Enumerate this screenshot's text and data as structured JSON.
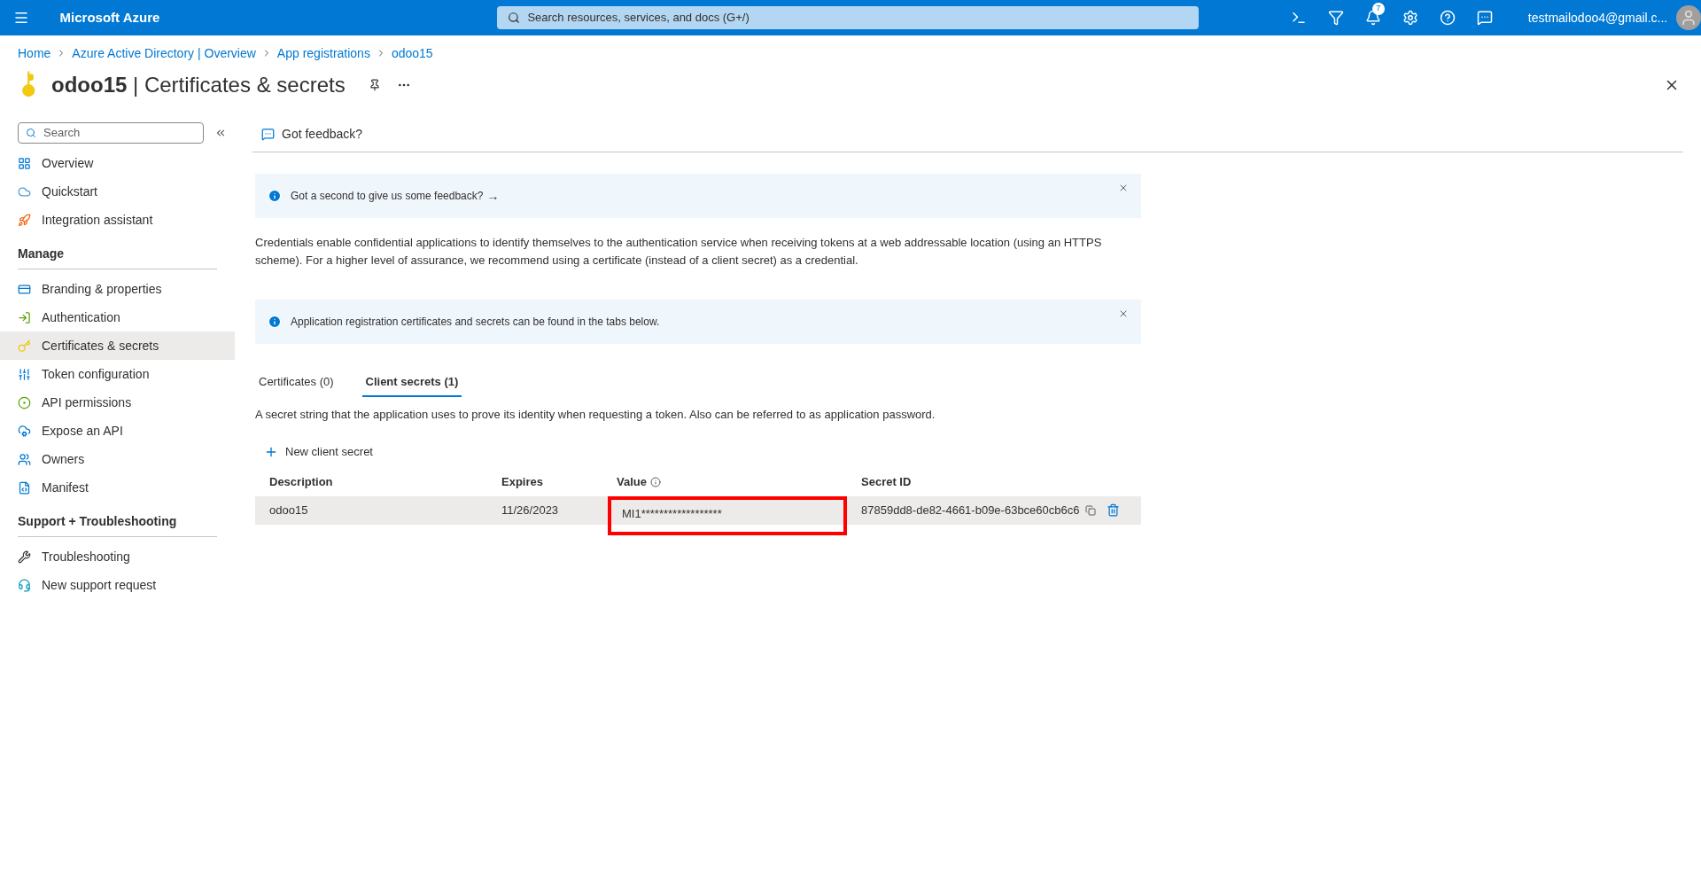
{
  "topbar": {
    "brand": "Microsoft Azure",
    "search": {
      "placeholder": "Search resources, services, and docs (G+/)"
    },
    "notification_count": "7",
    "account": "testmailodoo4@gmail.c..."
  },
  "breadcrumb": [
    "Home",
    "Azure Active Directory | Overview",
    "App registrations",
    "odoo15"
  ],
  "page_title": {
    "app": "odoo15",
    "separator": "|",
    "section": "Certificates & secrets"
  },
  "sidebar": {
    "search": {
      "placeholder": "Search"
    },
    "sections": [
      {
        "items": [
          {
            "label": "Overview",
            "selected": false
          },
          {
            "label": "Quickstart",
            "selected": false
          },
          {
            "label": "Integration assistant",
            "selected": false
          }
        ]
      },
      {
        "heading": "Manage",
        "items": [
          {
            "label": "Branding & properties",
            "selected": false
          },
          {
            "label": "Authentication",
            "selected": false
          },
          {
            "label": "Certificates & secrets",
            "selected": true
          },
          {
            "label": "Token configuration",
            "selected": false
          },
          {
            "label": "API permissions",
            "selected": false
          },
          {
            "label": "Expose an API",
            "selected": false
          },
          {
            "label": "Owners",
            "selected": false
          },
          {
            "label": "Manifest",
            "selected": false
          }
        ]
      },
      {
        "heading": "Support + Troubleshooting",
        "items": [
          {
            "label": "Troubleshooting",
            "selected": false
          },
          {
            "label": "New support request",
            "selected": false
          }
        ]
      }
    ]
  },
  "command_bar": {
    "feedback": "Got feedback?"
  },
  "banners": [
    {
      "text": "Got a second to give us some feedback?",
      "arrow": "→"
    },
    {
      "text": "Application registration certificates and secrets can be found in the tabs below."
    }
  ],
  "description": "Credentials enable confidential applications to identify themselves to the authentication service when receiving tokens at a web addressable location (using an HTTPS scheme). For a higher level of assurance, we recommend using a certificate (instead of a client secret) as a credential.",
  "tabs": [
    {
      "label": "Certificates (0)",
      "selected": false
    },
    {
      "label": "Client secrets (1)",
      "selected": true
    }
  ],
  "tab_description": "A secret string that the application uses to prove its identity when requesting a token. Also can be referred to as application password.",
  "new_secret_button": "New client secret",
  "table": {
    "columns": [
      "Description",
      "Expires",
      "Value",
      "Secret ID"
    ],
    "rows": [
      {
        "description": "odoo15",
        "expires": "11/26/2023",
        "value": "MI1******************",
        "value_highlighted": true,
        "secret_id": "87859dd8-de82-4661-b09e-63bce60cb6c6"
      }
    ]
  }
}
